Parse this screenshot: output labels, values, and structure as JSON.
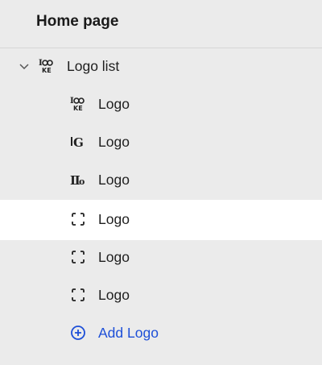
{
  "header": {
    "title": "Home page"
  },
  "tree": {
    "parent": {
      "label": "Logo list",
      "icon": "logo-image-icon",
      "expanded": true
    },
    "children": [
      {
        "label": "Logo",
        "icon": "logo-image-icon-1",
        "selected": false
      },
      {
        "label": "Logo",
        "icon": "logo-image-icon-2",
        "selected": false
      },
      {
        "label": "Logo",
        "icon": "logo-image-icon-3",
        "selected": false
      },
      {
        "label": "Logo",
        "icon": "image-placeholder-icon",
        "selected": true
      },
      {
        "label": "Logo",
        "icon": "image-placeholder-icon",
        "selected": false
      },
      {
        "label": "Logo",
        "icon": "image-placeholder-icon",
        "selected": false
      }
    ],
    "add": {
      "label": "Add Logo",
      "icon": "plus-circle-icon",
      "color": "#1d4fd8"
    }
  },
  "colors": {
    "background": "#ebebeb",
    "selected_row": "#ffffff",
    "accent": "#1d4fd8"
  }
}
